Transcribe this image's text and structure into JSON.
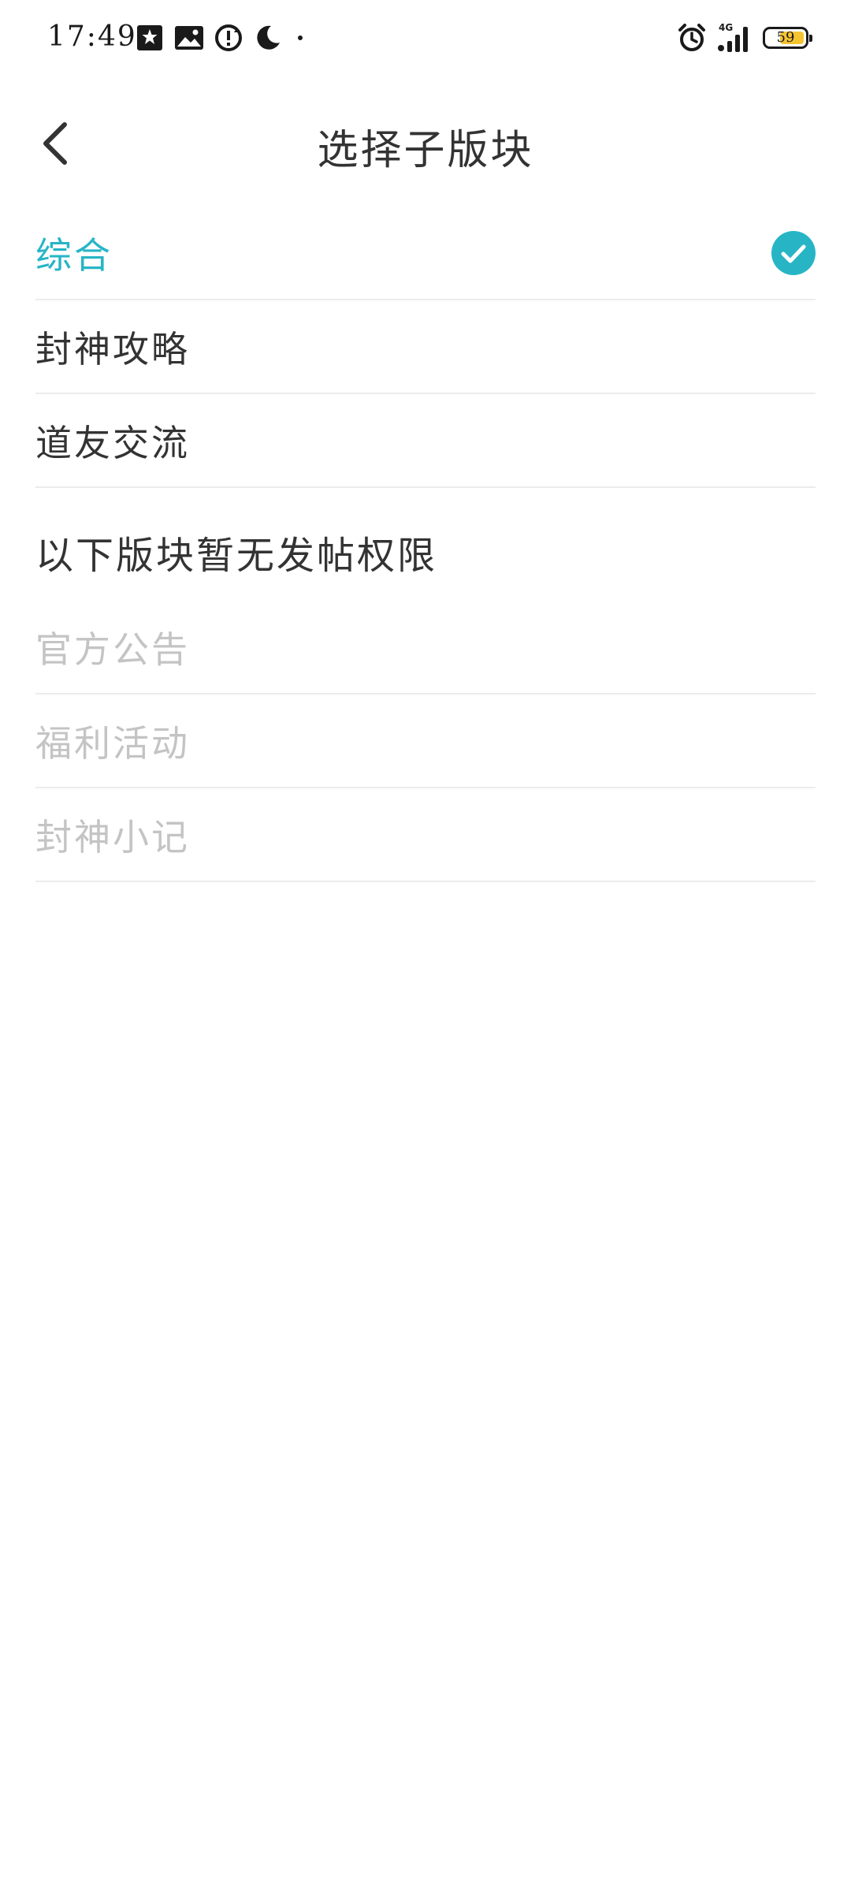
{
  "status_bar": {
    "time": "17:49",
    "left_icons": [
      "photo-sparkle-icon",
      "image-icon",
      "sync-alert-icon",
      "moon-icon"
    ],
    "right_icons": [
      "alarm-icon",
      "signal-4g-icon"
    ],
    "network_label": "4G",
    "battery_level": "59",
    "battery_color": "#f5c431"
  },
  "header": {
    "title": "选择子版块",
    "back_icon": "chevron-left-icon"
  },
  "postable_sections": [
    {
      "label": "综合",
      "selected": true
    },
    {
      "label": "封神攻略",
      "selected": false
    },
    {
      "label": "道友交流",
      "selected": false
    }
  ],
  "restricted_header": "以下版块暂无发帖权限",
  "restricted_sections": [
    {
      "label": "官方公告"
    },
    {
      "label": "福利活动"
    },
    {
      "label": "封神小记"
    }
  ],
  "colors": {
    "accent": "#27b5c6",
    "text": "#333333",
    "disabled_text": "#c4c4c4",
    "divider": "#ececec"
  }
}
